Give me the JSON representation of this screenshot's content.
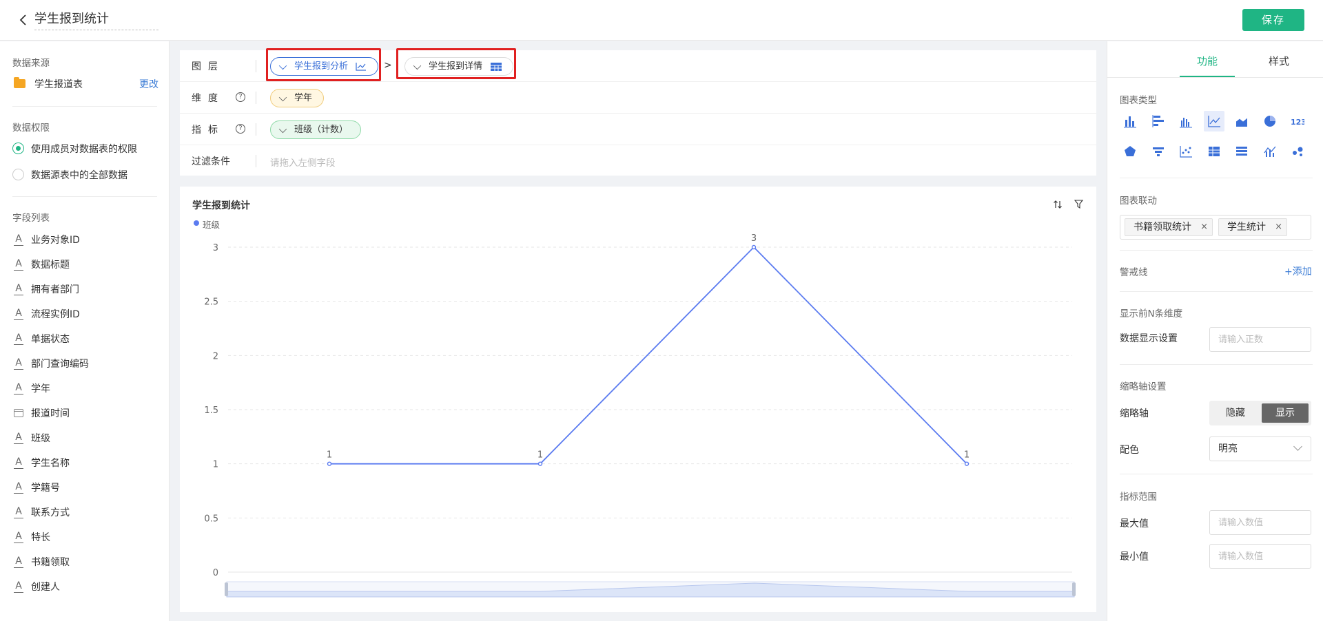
{
  "header": {
    "title": "学生报到统计",
    "save_label": "保存"
  },
  "left": {
    "datasource": {
      "title": "数据来源",
      "name": "学生报道表",
      "change": "更改"
    },
    "permission": {
      "title": "数据权限",
      "options": [
        "使用成员对数据表的权限",
        "数据源表中的全部数据"
      ],
      "selected": 0
    },
    "fields": {
      "title": "字段列表",
      "items": [
        {
          "label": "业务对象ID",
          "icon": "text-field-icon"
        },
        {
          "label": "数据标题",
          "icon": "text-field-icon"
        },
        {
          "label": "拥有者部门",
          "icon": "text-field-icon"
        },
        {
          "label": "流程实例ID",
          "icon": "text-field-icon"
        },
        {
          "label": "单据状态",
          "icon": "text-field-icon"
        },
        {
          "label": "部门查询编码",
          "icon": "text-field-icon"
        },
        {
          "label": "学年",
          "icon": "text-field-icon"
        },
        {
          "label": "报道时间",
          "icon": "calendar-icon"
        },
        {
          "label": "班级",
          "icon": "text-field-icon"
        },
        {
          "label": "学生名称",
          "icon": "text-field-icon"
        },
        {
          "label": "学籍号",
          "icon": "text-field-icon"
        },
        {
          "label": "联系方式",
          "icon": "text-field-icon"
        },
        {
          "label": "特长",
          "icon": "text-field-icon"
        },
        {
          "label": "书籍领取",
          "icon": "text-field-icon"
        },
        {
          "label": "创建人",
          "icon": "text-field-icon"
        }
      ]
    }
  },
  "config": {
    "layer": {
      "label": "图层",
      "items": [
        "学生报到分析",
        "学生报到详情"
      ],
      "separator": ">"
    },
    "dimension": {
      "label": "维度",
      "value": "学年"
    },
    "metric": {
      "label": "指标",
      "value": "班级（计数）"
    },
    "filter": {
      "label": "过滤条件",
      "placeholder": "请拖入左侧字段"
    }
  },
  "chart_data": {
    "type": "line",
    "title": "学生报到统计",
    "categories": [
      "",
      "",
      "",
      ""
    ],
    "series": [
      {
        "name": "班级",
        "values": [
          1,
          1,
          3,
          1
        ],
        "color": "#5b7bf0"
      }
    ],
    "y_ticks": [
      "0",
      "0.5",
      "1",
      "1.5",
      "2",
      "2.5",
      "3"
    ],
    "ylim": [
      0,
      3
    ],
    "grid": true,
    "data_labels": true,
    "legend": "top-left"
  },
  "right": {
    "tabs": [
      "功能",
      "样式"
    ],
    "active_tab": 0,
    "chart_type_title": "图表类型",
    "chart_types": [
      "bar-chart-icon",
      "horizontal-bar-icon",
      "grouped-bar-icon",
      "line-chart-icon",
      "area-chart-icon",
      "pie-chart-icon",
      "number-card-icon",
      "radar-chart-icon",
      "funnel-chart-icon",
      "scatter-chart-icon",
      "pivot-table-icon",
      "detail-table-icon",
      "combo-chart-icon",
      "map-chart-icon"
    ],
    "selected_chart_type": 3,
    "linkage": {
      "title": "图表联动",
      "tags": [
        "书籍领取统计",
        "学生统计"
      ]
    },
    "warning": {
      "title": "警戒线",
      "add": "+添加"
    },
    "topn": {
      "title": "显示前N条维度",
      "label": "数据显示设置",
      "placeholder": "请输入正数"
    },
    "thumb": {
      "title": "缩略轴设置",
      "label": "缩略轴",
      "options": [
        "隐藏",
        "显示"
      ],
      "selected": 1
    },
    "color": {
      "label": "配色",
      "value": "明亮"
    },
    "range": {
      "title": "指标范围",
      "max_label": "最大值",
      "min_label": "最小值",
      "placeholder": "请输入数值"
    }
  }
}
